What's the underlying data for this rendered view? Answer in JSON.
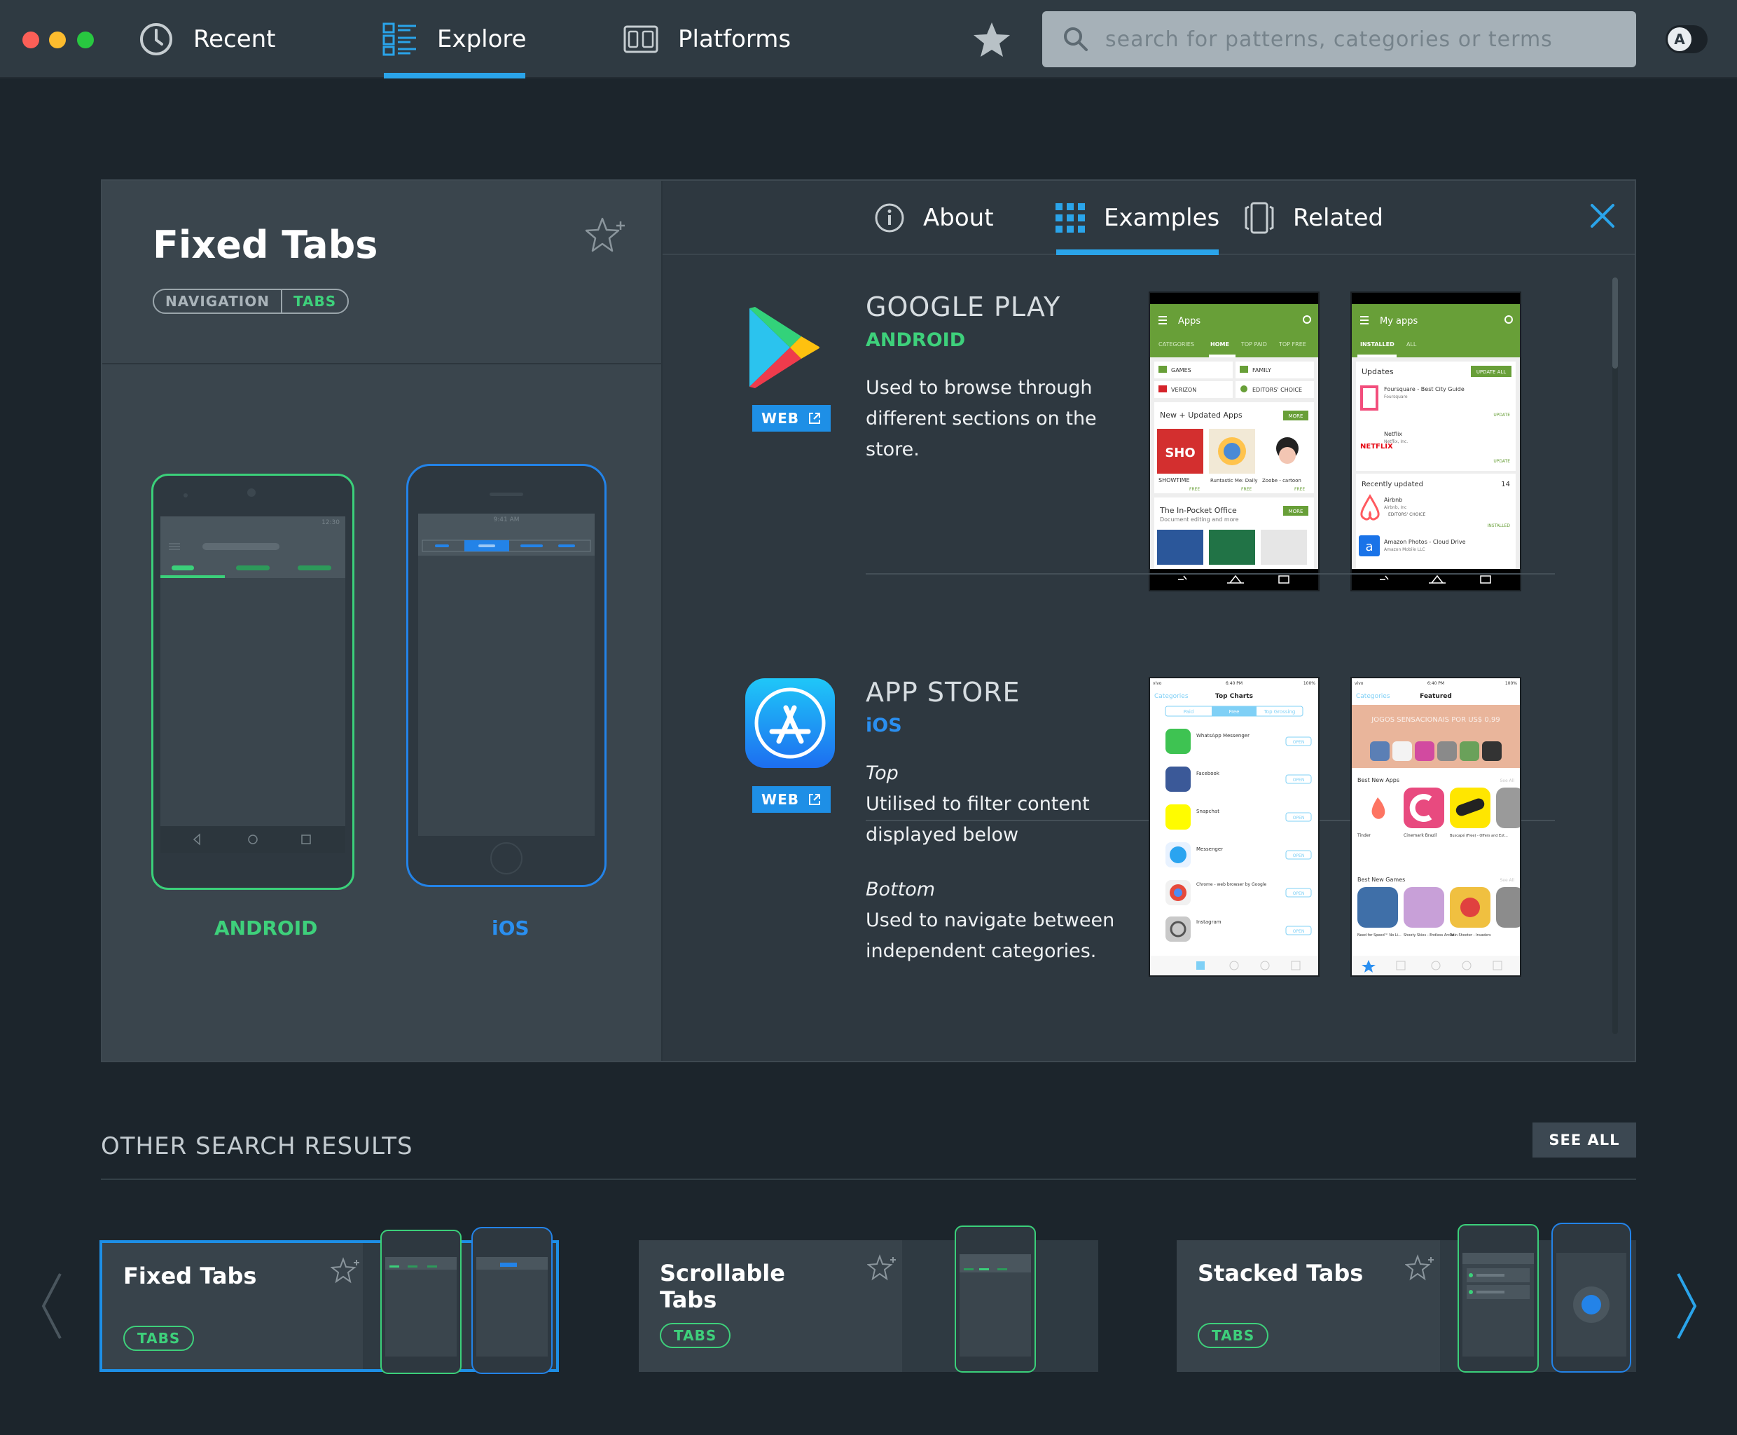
{
  "window": {
    "nav": {
      "recent": "Recent",
      "explore": "Explore",
      "platforms": "Platforms"
    },
    "search": {
      "placeholder": "search for patterns, categories or terms"
    },
    "avatar_letter": "A"
  },
  "pattern": {
    "title": "Fixed Tabs",
    "tags": [
      "NAVIGATION",
      "TABS"
    ],
    "platforms": {
      "android": "ANDROID",
      "ios": "iOS"
    }
  },
  "detail_tabs": {
    "about": "About",
    "examples": "Examples",
    "related": "Related"
  },
  "examples": [
    {
      "name": "GOOGLE PLAY",
      "platform": "ANDROID",
      "web": "WEB",
      "description": "Used to browse through different sections on the store."
    },
    {
      "name": "APP STORE",
      "platform": "iOS",
      "web": "WEB",
      "top_heading": "Top",
      "top_text": "Utilised to filter content displayed below",
      "bottom_heading": "Bottom",
      "bottom_text": "Used to navigate between independent categories."
    }
  ],
  "screenshots": {
    "gp1": {
      "title": "Apps",
      "tabs": [
        "CATEGORIES",
        "HOME",
        "TOP PAID",
        "TOP FREE"
      ],
      "tiles": [
        "GAMES",
        "FAMILY",
        "VERIZON",
        "EDITORS' CHOICE"
      ],
      "section1": "New + Updated Apps",
      "section2": "The In-Pocket Office",
      "section2_sub": "Document editing and more",
      "more": "MORE",
      "apps": [
        "SHOWTIME",
        "Runtastic Me: Daily",
        "Zoobe - cartoon"
      ],
      "free": "FREE"
    },
    "gp2": {
      "title": "My apps",
      "tabs": [
        "INSTALLED",
        "ALL"
      ],
      "updates": "Updates",
      "update_all": "UPDATE ALL",
      "update": "UPDATE",
      "recent": "Recently updated",
      "recent_count": "14",
      "installed": "INSTALLED",
      "apps": [
        {
          "name": "Foursquare - Best City Guide",
          "dev": "Foursquare"
        },
        {
          "name": "Netflix",
          "dev": "Netflix, Inc."
        },
        {
          "name": "Airbnb",
          "dev": "Airbnb, Inc"
        },
        {
          "name": "Amazon Photos - Cloud Drive",
          "dev": "Amazon Mobile LLC"
        }
      ],
      "editors": "EDITORS' CHOICE"
    },
    "as1": {
      "carrier": "vivo",
      "time": "6:40 PM",
      "battery": "100%",
      "categories": "Categories",
      "title": "Top Charts",
      "segments": [
        "Paid",
        "Free",
        "Top Grossing"
      ],
      "open": "OPEN",
      "apps": [
        "WhatsApp Messenger",
        "Facebook",
        "Snapchat",
        "Messenger",
        "Chrome - web browser by Google",
        "Instagram"
      ]
    },
    "as2": {
      "carrier": "vivo",
      "time": "6:40 PM",
      "battery": "100%",
      "categories": "Categories",
      "title": "Featured",
      "banner": "JOGOS SENSACIONAIS POR US$ 0,99",
      "best_apps": "Best New Apps",
      "best_games": "Best New Games",
      "see_all": "See All",
      "apps": [
        "Tinder",
        "Cinemark Brazil",
        "Buscapé (Free) - Offers and Ext..."
      ],
      "games": [
        "Need for Speed™ No Li...",
        "Shooty Skies - Endless Arcad...",
        "Twin Shooter - Invaders"
      ]
    }
  },
  "mock": {
    "android_time": "12:30",
    "ios_time": "9:41 AM"
  },
  "other_results": {
    "title": "OTHER SEARCH RESULTS",
    "see_all": "SEE ALL",
    "cards": [
      {
        "title": "Fixed Tabs",
        "tag": "TABS"
      },
      {
        "title": "Scrollable Tabs",
        "tag": "TABS"
      },
      {
        "title": "Stacked Tabs",
        "tag": "TABS"
      }
    ]
  },
  "colors": {
    "accent": "#2aa4ea",
    "android": "#3ed07b",
    "ios": "#2383e8",
    "play_green": "#689f38"
  }
}
